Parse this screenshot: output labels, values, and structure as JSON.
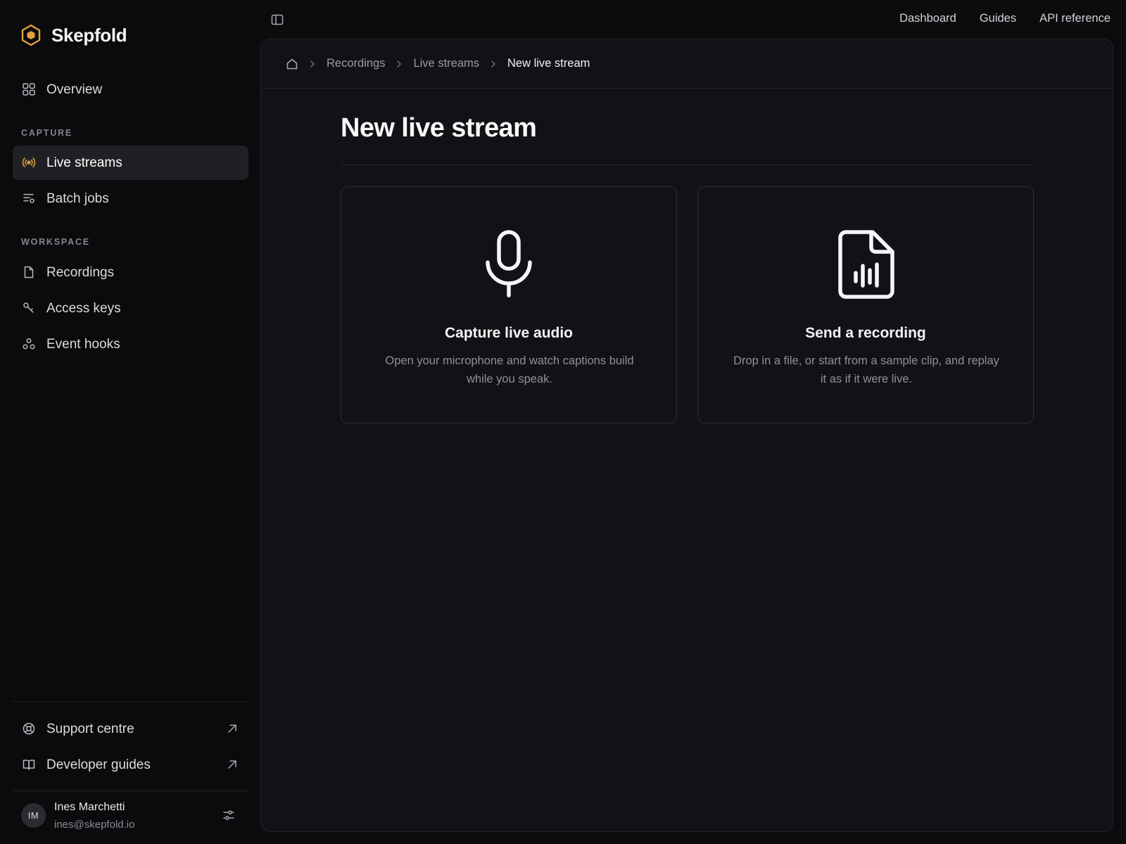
{
  "brand": {
    "name": "Skepfold",
    "accent": "#e0a040"
  },
  "sidebar": {
    "overview_label": "Overview",
    "capture_section": "CAPTURE",
    "live_streams_label": "Live streams",
    "batch_jobs_label": "Batch jobs",
    "workspace_section": "WORKSPACE",
    "recordings_label": "Recordings",
    "access_keys_label": "Access keys",
    "event_hooks_label": "Event hooks",
    "support_label": "Support centre",
    "dev_guides_label": "Developer guides",
    "active_item": "Live streams"
  },
  "user": {
    "initials": "IM",
    "name": "Ines Marchetti",
    "email": "ines@skepfold.io"
  },
  "topnav": {
    "dashboard": "Dashboard",
    "guides": "Guides",
    "api_reference": "API reference"
  },
  "breadcrumb": {
    "recordings": "Recordings",
    "live_streams": "Live streams",
    "current": "New live stream"
  },
  "page": {
    "title": "New live stream",
    "cards": [
      {
        "icon": "microphone-icon",
        "title": "Capture live audio",
        "description": "Open your microphone and watch captions build while you speak."
      },
      {
        "icon": "audio-file-icon",
        "title": "Send a recording",
        "description": "Drop in a file, or start from a sample clip, and replay it as if it were live."
      }
    ]
  }
}
